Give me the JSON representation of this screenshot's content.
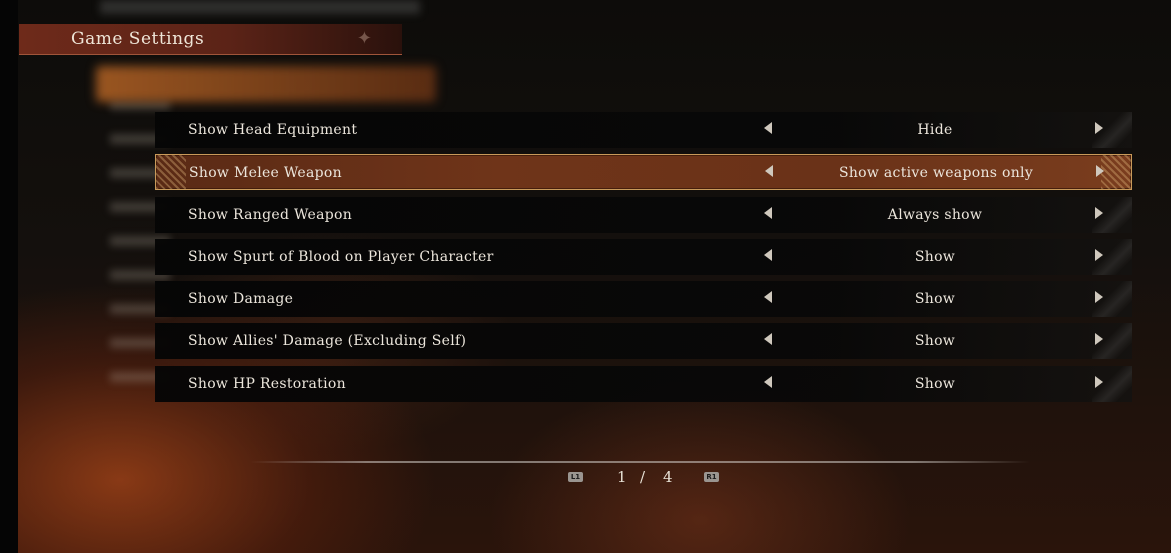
{
  "header": {
    "title": "Game Settings"
  },
  "settings": [
    {
      "label": "Show Head Equipment",
      "value": "Hide",
      "selected": false
    },
    {
      "label": "Show Melee Weapon",
      "value": "Show active weapons only",
      "selected": true
    },
    {
      "label": "Show Ranged Weapon",
      "value": "Always show",
      "selected": false
    },
    {
      "label": "Show Spurt of Blood on Player Character",
      "value": "Show",
      "selected": false
    },
    {
      "label": "Show Damage",
      "value": "Show",
      "selected": false
    },
    {
      "label": "Show Allies' Damage (Excluding Self)",
      "value": "Show",
      "selected": false
    },
    {
      "label": "Show HP Restoration",
      "value": "Show",
      "selected": false
    }
  ],
  "pager": {
    "prev_button": "L1",
    "next_button": "R1",
    "current": "1",
    "separator": "/",
    "total": "4"
  },
  "colors": {
    "selected_row": "#6f3419",
    "header_bg": "#6e2a1a",
    "selected_border": "#c99a5a"
  }
}
